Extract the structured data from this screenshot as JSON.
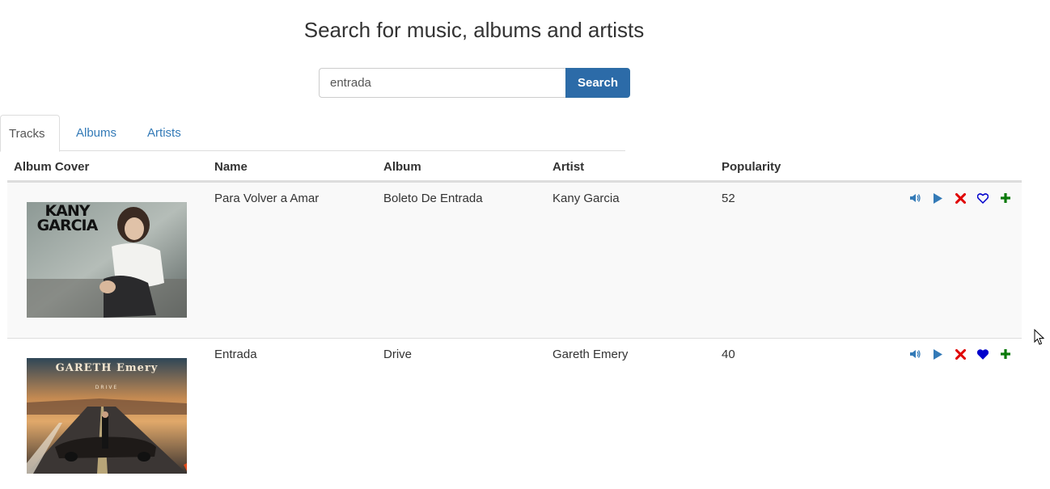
{
  "title": "Search for music, albums and artists",
  "search": {
    "value": "entrada",
    "button_label": "Search"
  },
  "tabs": [
    {
      "label": "Tracks",
      "active": true
    },
    {
      "label": "Albums",
      "active": false
    },
    {
      "label": "Artists",
      "active": false
    }
  ],
  "table": {
    "headers": {
      "cover": "Album Cover",
      "name": "Name",
      "album": "Album",
      "artist": "Artist",
      "popularity": "Popularity"
    },
    "rows": [
      {
        "cover_text": "KANY GARCIA",
        "name": "Para Volver a Amar",
        "album": "Boleto De Entrada",
        "artist": "Kany Garcia",
        "popularity": "52",
        "favorited": false
      },
      {
        "cover_text": "GARETH Emery",
        "cover_subtext": "DRIVE",
        "name": "Entrada",
        "album": "Drive",
        "artist": "Gareth Emery",
        "popularity": "40",
        "favorited": true
      }
    ]
  },
  "colors": {
    "link": "#337ab7",
    "button": "#2c6ba8",
    "remove": "#e00000",
    "favorite": "#0000cc",
    "add": "#0a7a0a"
  },
  "icons": [
    "volume-icon",
    "play-icon",
    "remove-icon",
    "heart-icon",
    "add-icon"
  ]
}
